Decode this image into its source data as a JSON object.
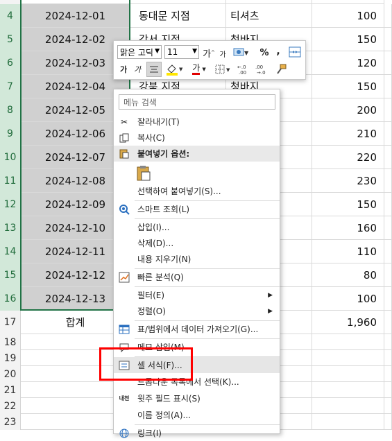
{
  "rows": [
    {
      "num": "4",
      "date": "2024-12-01",
      "branch": "동대문 지점",
      "product": "티셔츠",
      "qty": "100"
    },
    {
      "num": "5",
      "date": "2024-12-02",
      "branch": "강서 지점",
      "product": "청바지",
      "qty": "150"
    },
    {
      "num": "6",
      "date": "2024-12-03",
      "branch": "",
      "product": "",
      "qty": "120"
    },
    {
      "num": "7",
      "date": "2024-12-04",
      "branch": "강북 지점",
      "product": "청바지",
      "qty": "150"
    },
    {
      "num": "8",
      "date": "2024-12-05",
      "branch": "",
      "product": "",
      "qty": "200"
    },
    {
      "num": "9",
      "date": "2024-12-06",
      "branch": "",
      "product": "",
      "qty": "210"
    },
    {
      "num": "10",
      "date": "2024-12-07",
      "branch": "",
      "product": "",
      "qty": "220"
    },
    {
      "num": "11",
      "date": "2024-12-08",
      "branch": "",
      "product": "",
      "qty": "230"
    },
    {
      "num": "12",
      "date": "2024-12-09",
      "branch": "",
      "product": "",
      "qty": "150"
    },
    {
      "num": "13",
      "date": "2024-12-10",
      "branch": "",
      "product": "",
      "qty": "160"
    },
    {
      "num": "14",
      "date": "2024-12-11",
      "branch": "",
      "product": "",
      "qty": "110"
    },
    {
      "num": "15",
      "date": "2024-12-12",
      "branch": "",
      "product": "",
      "qty": "80"
    },
    {
      "num": "16",
      "date": "2024-12-13",
      "branch": "",
      "product": "",
      "qty": "100"
    }
  ],
  "total": {
    "num": "17",
    "label": "합계",
    "qty": "1,960"
  },
  "empty_rows": [
    "18",
    "19",
    "20",
    "21",
    "22",
    "23"
  ],
  "mini_toolbar": {
    "font_name": "맑은 고딕",
    "font_size": "11",
    "percent": "%",
    "comma": ",",
    "bold": "가",
    "italic": "가",
    "font_color_glyph": "가",
    "grow_font": "가",
    "shrink_font": "가"
  },
  "menu": {
    "search_placeholder": "메뉴 검색",
    "items": {
      "cut": "잘라내기(T)",
      "copy": "복사(C)",
      "paste_options": "붙여넣기 옵션:",
      "paste_special": "선택하여 붙여넣기(S)...",
      "smart_lookup": "스마트 조회(L)",
      "insert": "삽입(I)...",
      "delete": "삭제(D)...",
      "clear": "내용 지우기(N)",
      "quick_analysis": "빠른 분석(Q)",
      "filter": "필터(E)",
      "sort": "정렬(O)",
      "get_data": "표/범위에서 데이터 가져오기(G)...",
      "insert_comment": "메모 삽입(M)",
      "format_cells": "셀 서식(F)...",
      "pick_list": "드롭다운 목록에서 선택(K)...",
      "phonetic": "윗주 필드 표시(S)",
      "define_name": "이름 정의(A)...",
      "link": "링크(I)"
    },
    "phonetic_icon_text": "내천"
  },
  "colors": {
    "selection_border": "#217346",
    "highlight": "#ff0000"
  }
}
